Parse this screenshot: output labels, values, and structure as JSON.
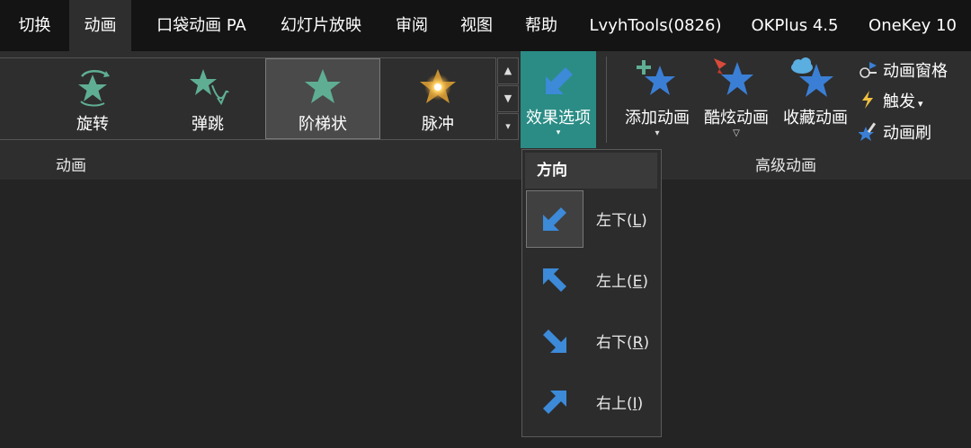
{
  "tabs": [
    {
      "label": "切换",
      "active": false
    },
    {
      "label": "动画",
      "active": true
    },
    {
      "label": "口袋动画 PA",
      "active": false
    },
    {
      "label": "幻灯片放映",
      "active": false
    },
    {
      "label": "审阅",
      "active": false
    },
    {
      "label": "视图",
      "active": false
    },
    {
      "label": "帮助",
      "active": false
    },
    {
      "label": "LvyhTools(0826)",
      "active": false
    },
    {
      "label": "OKPlus 4.5",
      "active": false
    },
    {
      "label": "OneKey 10",
      "active": false
    }
  ],
  "gallery": {
    "items": [
      {
        "label": "旋转",
        "icon": "spin-star-icon"
      },
      {
        "label": "弹跳",
        "icon": "bounce-star-icon"
      },
      {
        "label": "阶梯状",
        "icon": "star-icon",
        "selected": true
      },
      {
        "label": "脉冲",
        "icon": "pulse-icon"
      }
    ],
    "scroll_up": "▲",
    "scroll_down": "▼",
    "more": "▾"
  },
  "groups": {
    "animation": "动画",
    "advanced": "高级动画"
  },
  "effect_options": {
    "label": "效果选项",
    "caret": "▾",
    "icon": "arrow-down-left-icon"
  },
  "advanced": {
    "add_animation": {
      "label": "添加动画",
      "caret": "▾"
    },
    "cool_animation": {
      "label": "酷炫动画",
      "caret": "▽"
    },
    "favorite_animation": {
      "label": "收藏动画"
    },
    "animation_pane": {
      "label": "动画窗格"
    },
    "trigger": {
      "label": "触发",
      "caret": "▾"
    },
    "animation_painter": {
      "label": "动画刷"
    }
  },
  "menu": {
    "header": "方向",
    "items": [
      {
        "text": "左下(",
        "key": "L",
        "end": ")",
        "icon": "arrow-down-left-icon",
        "selected": true
      },
      {
        "text": "左上(",
        "key": "E",
        "end": ")",
        "icon": "arrow-up-left-icon",
        "selected": false
      },
      {
        "text": "右下(",
        "key": "R",
        "end": ")",
        "icon": "arrow-down-right-icon",
        "selected": false
      },
      {
        "text": "右上(",
        "key": "I",
        "end": ")",
        "icon": "arrow-up-right-icon",
        "selected": false
      }
    ]
  },
  "colors": {
    "accent": "#2a8c85",
    "star_green": "#5fae93",
    "star_blue": "#3a7fd5",
    "arrow_blue": "#3c8ad8"
  }
}
